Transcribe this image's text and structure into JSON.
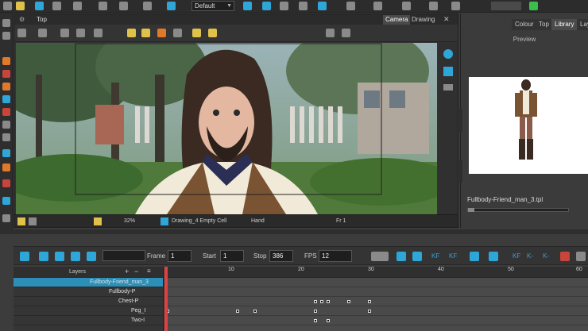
{
  "toolbar": {
    "preset": "Default"
  },
  "camera_view": {
    "title": "Top",
    "tabs": [
      "Camera",
      "Drawing"
    ],
    "active_tab": "Camera",
    "status": {
      "zoom": "32%",
      "drawing": "Drawing_4 Empty Cell",
      "tool": "Hand",
      "frame": "Fr 1"
    }
  },
  "right_panel": {
    "tabs": [
      "Colour",
      "Top",
      "Library",
      "Lay"
    ],
    "active_tab": "Library",
    "preview_label": "Preview",
    "file_name": "Fullbody-Friend_man_3.tpl"
  },
  "timeline": {
    "frame_label": "Frame",
    "frame_value": "1",
    "start_label": "Start",
    "start_value": "1",
    "stop_label": "Stop",
    "stop_value": "386",
    "fps_label": "FPS",
    "fps_value": "12",
    "layers_header": "Layers",
    "ruler": [
      "10",
      "20",
      "30",
      "40",
      "50",
      "60"
    ],
    "layers": [
      {
        "name": "Fullbody-Friend_man_3",
        "selected": true
      },
      {
        "name": "Fullbody-P"
      },
      {
        "name": "Chest-P"
      },
      {
        "name": "Peg_I"
      },
      {
        "name": "Two-I"
      }
    ],
    "keyframe_tools": [
      "KF",
      "KF",
      "KF",
      "K-",
      "K-"
    ]
  },
  "colors": {
    "accent": "#2ea6d8",
    "playhead": "#e04040",
    "selected_layer": "#2b8fb8"
  }
}
